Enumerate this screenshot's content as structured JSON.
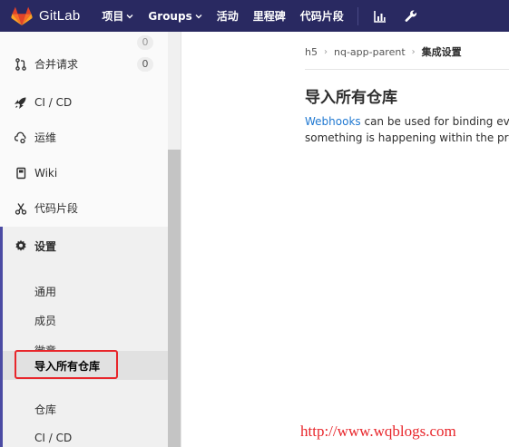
{
  "navbar": {
    "brand": "GitLab",
    "items": [
      {
        "label": "项目",
        "dropdown": true
      },
      {
        "label": "Groups",
        "dropdown": true
      },
      {
        "label": "活动"
      },
      {
        "label": "里程碑"
      },
      {
        "label": "代码片段"
      }
    ],
    "icons": [
      "chart-icon",
      "wrench-icon"
    ]
  },
  "sidebar": {
    "partial_count": "0",
    "items": [
      {
        "label": "合并请求",
        "icon": "merge-request-icon",
        "count": "0"
      },
      {
        "label": "CI / CD",
        "icon": "rocket-icon"
      },
      {
        "label": "运维",
        "icon": "cloud-gear-icon"
      },
      {
        "label": "Wiki",
        "icon": "book-icon"
      },
      {
        "label": "代码片段",
        "icon": "scissors-icon"
      }
    ],
    "settings": {
      "label": "设置",
      "icon": "gear-icon",
      "subitems": [
        {
          "label": "通用"
        },
        {
          "label": "成员"
        },
        {
          "label": "徽章"
        },
        {
          "label": "导入所有仓库",
          "active": true
        },
        {
          "label": "仓库"
        },
        {
          "label": "CI / CD"
        }
      ]
    }
  },
  "breadcrumb": [
    "h5",
    "nq-app-parent",
    "集成设置"
  ],
  "main": {
    "title": "导入所有仓库",
    "desc_link": "Webhooks",
    "desc_line1": " can be used for binding events",
    "desc_line2": "something is happening within the project"
  },
  "watermark": "http://www.wqblogs.com",
  "colors": {
    "navbar": "#292961",
    "accent": "#4b4ba3",
    "link": "#1f78d1",
    "highlight": "#e8262b"
  }
}
